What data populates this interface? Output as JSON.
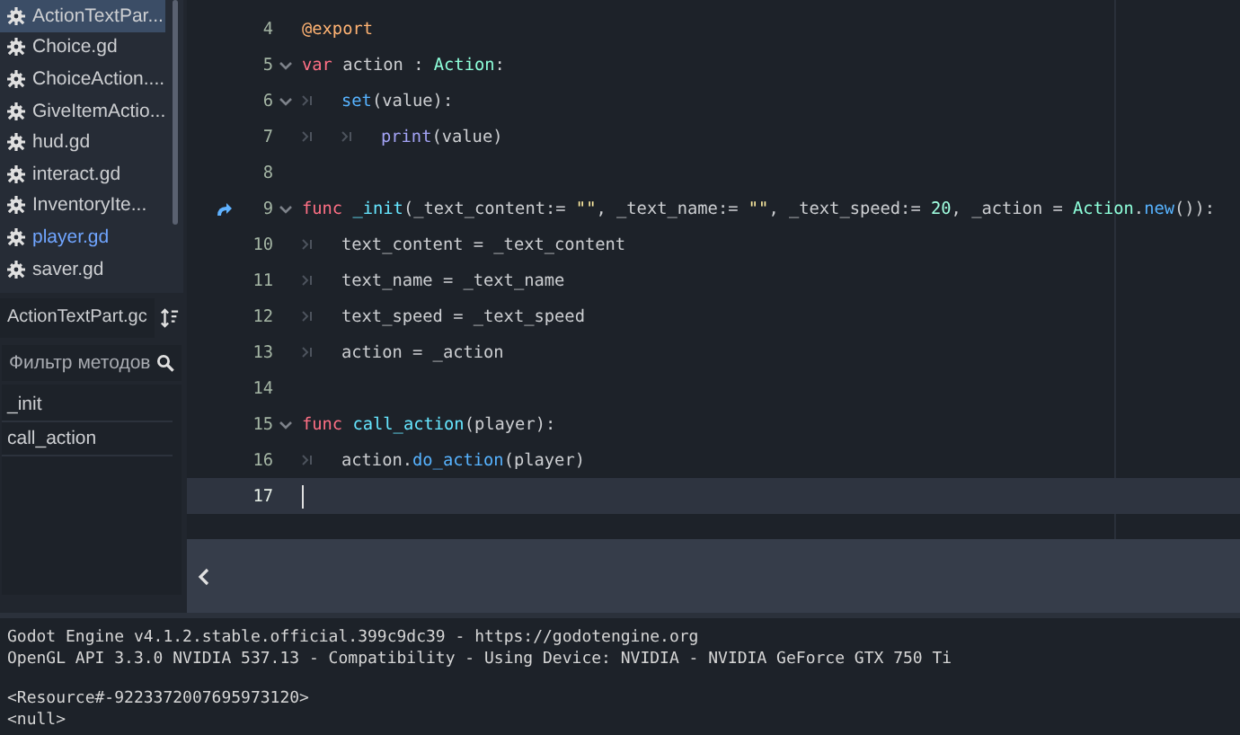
{
  "scripts": [
    {
      "name": "ActionTextPar...",
      "selected": true,
      "highlighted": false
    },
    {
      "name": "Choice.gd",
      "selected": false,
      "highlighted": false
    },
    {
      "name": "ChoiceAction....",
      "selected": false,
      "highlighted": false
    },
    {
      "name": "GiveItemActio...",
      "selected": false,
      "highlighted": false
    },
    {
      "name": "hud.gd",
      "selected": false,
      "highlighted": false
    },
    {
      "name": "interact.gd",
      "selected": false,
      "highlighted": false
    },
    {
      "name": "InventoryIte...",
      "selected": false,
      "highlighted": false
    },
    {
      "name": "player.gd",
      "selected": false,
      "highlighted": true
    },
    {
      "name": "saver.gd",
      "selected": false,
      "highlighted": false
    }
  ],
  "current_script": "ActionTextPart.gc",
  "method_filter": {
    "placeholder": "Фильтр методов"
  },
  "methods": [
    {
      "name": "_init"
    },
    {
      "name": "call_action"
    }
  ],
  "code_lines": [
    {
      "number": "4",
      "foldable": false,
      "override": false,
      "selected": false,
      "tokens": [
        {
          "kind": "annotation",
          "text": "@export"
        }
      ]
    },
    {
      "number": "5",
      "foldable": true,
      "override": false,
      "selected": false,
      "tokens": [
        {
          "kind": "keyword",
          "text": "var"
        },
        {
          "kind": "plain",
          "text": " action : "
        },
        {
          "kind": "type",
          "text": "Action"
        },
        {
          "kind": "plain",
          "text": ":"
        }
      ]
    },
    {
      "number": "6",
      "foldable": true,
      "override": false,
      "selected": false,
      "tokens": [
        {
          "kind": "tab"
        },
        {
          "kind": "call",
          "text": "set"
        },
        {
          "kind": "plain",
          "text": "(value):"
        }
      ]
    },
    {
      "number": "7",
      "foldable": false,
      "override": false,
      "selected": false,
      "tokens": [
        {
          "kind": "tab"
        },
        {
          "kind": "tab"
        },
        {
          "kind": "builtin",
          "text": "print"
        },
        {
          "kind": "plain",
          "text": "(value)"
        }
      ]
    },
    {
      "number": "8",
      "foldable": false,
      "override": false,
      "selected": false
    },
    {
      "number": "9",
      "foldable": true,
      "override": true,
      "selected": false,
      "tokens": [
        {
          "kind": "keyword",
          "text": "func "
        },
        {
          "kind": "function",
          "text": "_init"
        },
        {
          "kind": "plain",
          "text": "(_text_content:= "
        },
        {
          "kind": "string",
          "text": "\"\""
        },
        {
          "kind": "plain",
          "text": ", _text_name:= "
        },
        {
          "kind": "string",
          "text": "\"\""
        },
        {
          "kind": "plain",
          "text": ", _text_speed:= "
        },
        {
          "kind": "number",
          "text": "20"
        },
        {
          "kind": "plain",
          "text": ", _action = "
        },
        {
          "kind": "type",
          "text": "Action"
        },
        {
          "kind": "plain",
          "text": "."
        },
        {
          "kind": "call",
          "text": "new"
        },
        {
          "kind": "plain",
          "text": "()):"
        }
      ]
    },
    {
      "number": "10",
      "foldable": false,
      "override": false,
      "selected": false,
      "tokens": [
        {
          "kind": "tab"
        },
        {
          "kind": "plain",
          "text": "text_content = _text_content"
        }
      ]
    },
    {
      "number": "11",
      "foldable": false,
      "override": false,
      "selected": false,
      "tokens": [
        {
          "kind": "tab"
        },
        {
          "kind": "plain",
          "text": "text_name = _text_name"
        }
      ]
    },
    {
      "number": "12",
      "foldable": false,
      "override": false,
      "selected": false,
      "tokens": [
        {
          "kind": "tab"
        },
        {
          "kind": "plain",
          "text": "text_speed = _text_speed"
        }
      ]
    },
    {
      "number": "13",
      "foldable": false,
      "override": false,
      "selected": false,
      "tokens": [
        {
          "kind": "tab"
        },
        {
          "kind": "plain",
          "text": "action = _action"
        }
      ]
    },
    {
      "number": "14",
      "foldable": false,
      "override": false,
      "selected": false
    },
    {
      "number": "15",
      "foldable": true,
      "override": false,
      "selected": false,
      "tokens": [
        {
          "kind": "keyword",
          "text": "func "
        },
        {
          "kind": "function",
          "text": "call_action"
        },
        {
          "kind": "plain",
          "text": "(player):"
        }
      ]
    },
    {
      "number": "16",
      "foldable": false,
      "override": false,
      "selected": false,
      "tokens": [
        {
          "kind": "tab"
        },
        {
          "kind": "plain",
          "text": "action."
        },
        {
          "kind": "call",
          "text": "do_action"
        },
        {
          "kind": "plain",
          "text": "(player)"
        }
      ]
    },
    {
      "number": "17",
      "foldable": false,
      "override": false,
      "selected": true
    }
  ],
  "output": [
    [
      "Godot Engine v4.1.2.stable.official.399c9dc39 - https://godotengine.org",
      "OpenGL API 3.3.0 NVIDIA 537.13 - Compatibility - Using Device: NVIDIA - NVIDIA GeForce GTX 750 Ti"
    ],
    [
      "<Resource#-9223372007695973120>",
      "<null>"
    ]
  ]
}
